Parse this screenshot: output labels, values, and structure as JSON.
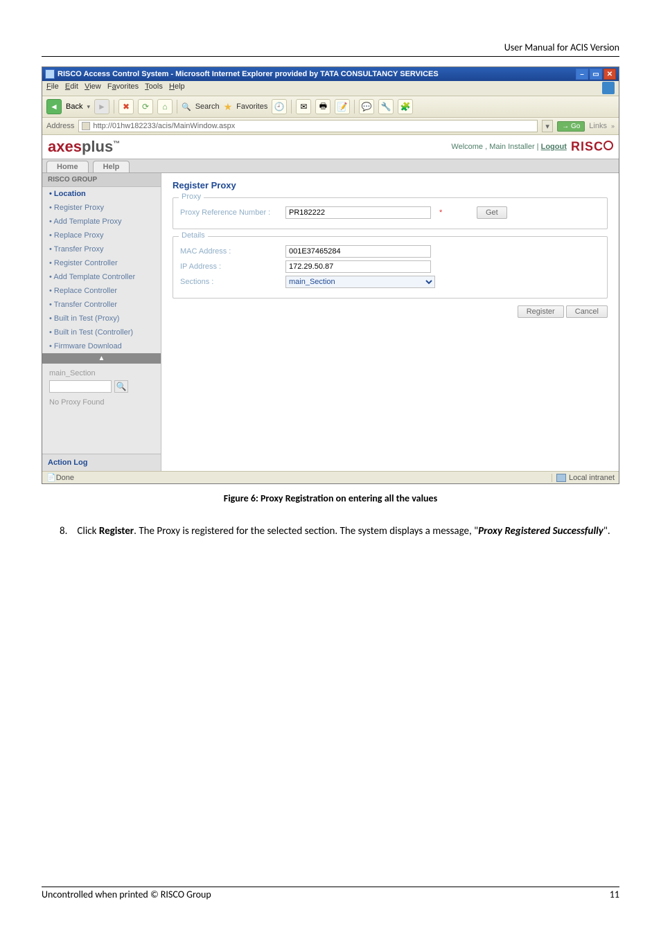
{
  "header": "User Manual for ACIS Version",
  "window": {
    "title": "RISCO Access Control System - Microsoft Internet Explorer provided by TATA CONSULTANCY SERVICES",
    "menus": [
      "File",
      "Edit",
      "View",
      "Favorites",
      "Tools",
      "Help"
    ],
    "toolbar": {
      "back": "Back",
      "search": "Search",
      "favorites": "Favorites"
    },
    "address_label": "Address",
    "url": "http://01hw182233/acis/MainWindow.aspx",
    "go": "Go",
    "links": "Links",
    "brand_ax": "axes",
    "brand_plus": "plus",
    "welcome": "Welcome , Main Installer | ",
    "logout": "Logout",
    "brandr": "RISC",
    "tab_home": "Home",
    "tab_help": "Help"
  },
  "sidebar": {
    "group": "RISCO GROUP",
    "items": [
      "Location",
      "Register Proxy",
      "Add Template Proxy",
      "Replace Proxy",
      "Transfer Proxy",
      "Register Controller",
      "Add Template Controller",
      "Replace Controller",
      "Transfer Controller",
      "Built in Test (Proxy)",
      "Built in Test (Controller)",
      "Firmware Download"
    ],
    "search_label": "main_Section",
    "no_proxy": "No Proxy Found",
    "action_log": "Action Log"
  },
  "content": {
    "title": "Register Proxy",
    "proxy_legend": "Proxy",
    "proxy_ref_lbl": "Proxy Reference Number :",
    "proxy_ref_val": "PR182222",
    "get": "Get",
    "details_legend": "Details",
    "mac_lbl": "MAC Address :",
    "mac_val": "001E37465284",
    "ip_lbl": "IP Address :",
    "ip_val": "172.29.50.87",
    "sections_lbl": "Sections :",
    "sections_val": "main_Section",
    "register": "Register",
    "cancel": "Cancel"
  },
  "status": {
    "done": "Done",
    "zone": "Local intranet"
  },
  "caption": "Figure 6: Proxy Registration on entering all the values",
  "body": {
    "num": "8.",
    "text_before": "Click ",
    "register": "Register",
    "text_mid": ". The Proxy is registered for the selected section. The system displays a message, \"",
    "msg": "Proxy Registered Successfully",
    "text_after": "\"."
  },
  "footer": {
    "left": "Uncontrolled when printed © RISCO Group",
    "right": "11"
  }
}
